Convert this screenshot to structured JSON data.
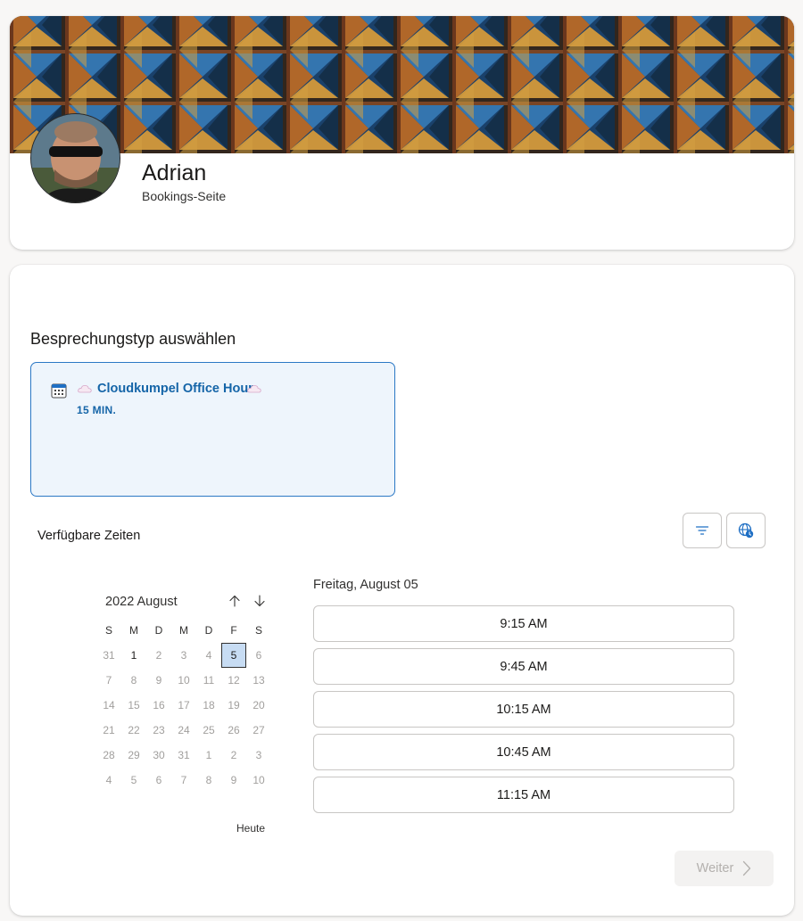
{
  "profile": {
    "name": "Adrian",
    "subtitle": "Bookings-Seite"
  },
  "booking": {
    "section_title": "Besprechungstyp auswählen",
    "service": {
      "name": "Cloudkumpel Office Hour",
      "duration": "15 MIN.",
      "icon": "calendar-icon",
      "accent": "#1565a8"
    },
    "available_label": "Verfügbare Zeiten",
    "filter_icon": "filter-icon",
    "timezone_icon": "globe-clock-icon"
  },
  "calendar": {
    "month_label": "2022 August",
    "weekdays": [
      "S",
      "M",
      "D",
      "M",
      "D",
      "F",
      "S"
    ],
    "weeks": [
      [
        "31",
        "1",
        "2",
        "3",
        "4",
        "5",
        "6"
      ],
      [
        "7",
        "8",
        "9",
        "10",
        "11",
        "12",
        "13"
      ],
      [
        "14",
        "15",
        "16",
        "17",
        "18",
        "19",
        "20"
      ],
      [
        "21",
        "22",
        "23",
        "24",
        "25",
        "26",
        "27"
      ],
      [
        "28",
        "29",
        "30",
        "31",
        "1",
        "2",
        "3"
      ],
      [
        "4",
        "5",
        "6",
        "7",
        "8",
        "9",
        "10"
      ]
    ],
    "enabled_days": [
      "1",
      "5"
    ],
    "selected_day": "5",
    "today_label": "Heute"
  },
  "slots": {
    "day_heading": "Freitag, August 05",
    "times": [
      "9:15 AM",
      "9:45 AM",
      "10:15 AM",
      "10:45 AM",
      "11:15 AM"
    ]
  },
  "footer": {
    "next_label": "Weiter"
  }
}
